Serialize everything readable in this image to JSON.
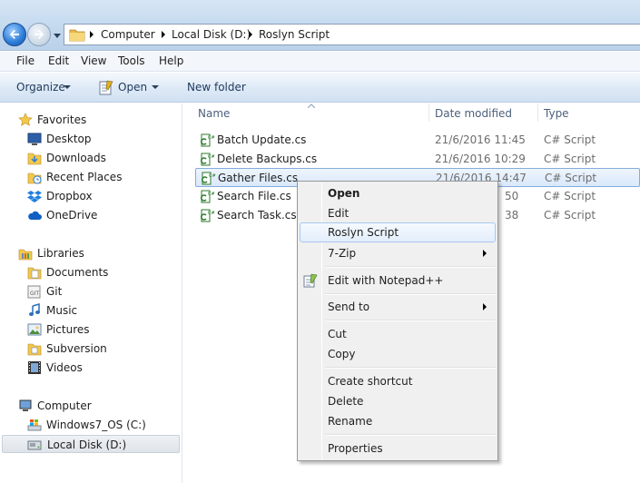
{
  "address": {
    "breadcrumbs": [
      "Computer",
      "Local Disk (D:)",
      "Roslyn Script"
    ]
  },
  "menubar": [
    "File",
    "Edit",
    "View",
    "Tools",
    "Help"
  ],
  "commandbar": {
    "organize": "Organize",
    "open": "Open",
    "new_folder": "New folder"
  },
  "nav": {
    "favorites": "Favorites",
    "fav_items": [
      "Desktop",
      "Downloads",
      "Recent Places",
      "Dropbox",
      "OneDrive"
    ],
    "libraries": "Libraries",
    "lib_items": [
      "Documents",
      "Git",
      "Music",
      "Pictures",
      "Subversion",
      "Videos"
    ],
    "computer": "Computer",
    "drives": [
      "Windows7_OS (C:)",
      "Local Disk (D:)"
    ]
  },
  "columns": {
    "name": "Name",
    "date": "Date modified",
    "type": "Type"
  },
  "files": [
    {
      "name": "Batch Update.cs",
      "date": "21/6/2016 11:45",
      "type": "C# Script"
    },
    {
      "name": "Delete Backups.cs",
      "date": "21/6/2016 10:29",
      "type": "C# Script"
    },
    {
      "name": "Gather Files.cs",
      "date": "21/6/2016 14:47",
      "type": "C# Script"
    },
    {
      "name": "Search File.cs",
      "date": "50",
      "type": "C# Script"
    },
    {
      "name": "Search Task.cs",
      "date": "38",
      "type": "C# Script"
    }
  ],
  "context_menu": {
    "open": "Open",
    "edit": "Edit",
    "roslyn": "Roslyn Script",
    "zip": "7-Zip",
    "notepad": "Edit with Notepad++",
    "sendto": "Send to",
    "cut": "Cut",
    "copy": "Copy",
    "shortcut": "Create shortcut",
    "delete": "Delete",
    "rename": "Rename",
    "properties": "Properties"
  },
  "colors": {
    "selection_border": "#84acdd",
    "folder_yellow": "#f2c94c",
    "accent_blue": "#2b7ad8"
  }
}
